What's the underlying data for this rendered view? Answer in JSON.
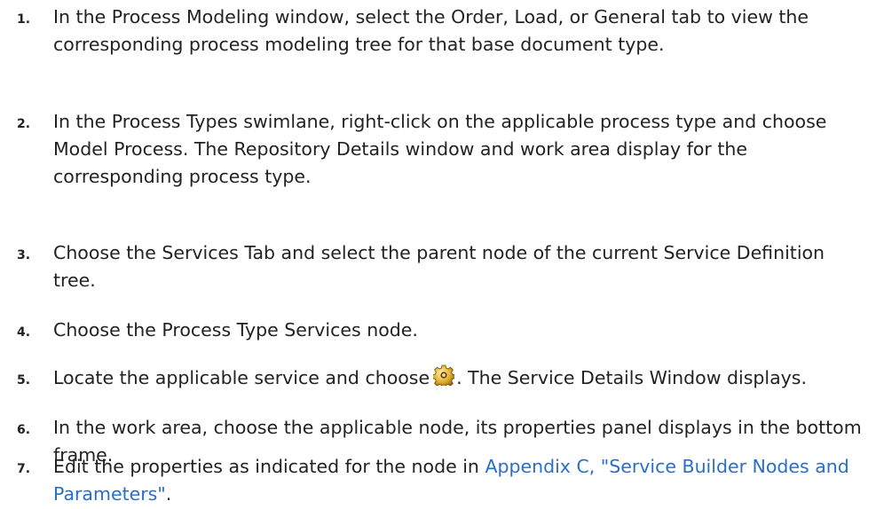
{
  "steps": [
    {
      "number": "1.",
      "text": "In the Process Modeling window, select the Order, Load, or General tab to view the corresponding process modeling tree for that base document type."
    },
    {
      "number": "2.",
      "text": "In the Process Types swimlane, right-click on the applicable process type and choose Model Process. The Repository Details window and work area display for the corresponding process type."
    },
    {
      "number": "3.",
      "text": "Choose the Services Tab and select the parent node of the current Service Definition tree."
    },
    {
      "number": "4.",
      "text": "Choose the Process Type Services node."
    },
    {
      "number": "5.",
      "text_before": "Locate the applicable service and choose",
      "icon": "gear-icon",
      "text_after": ". The Service Details Window displays."
    },
    {
      "number": "6.",
      "text": "In the work area, choose the applicable node, its properties panel displays in the bottom frame."
    },
    {
      "number": "7.",
      "text_before": "Edit the properties as indicated for the node in",
      "link_text": "Appendix C, \"Service Builder Nodes and Parameters\"",
      "text_after": "."
    }
  ],
  "colors": {
    "text": "#222222",
    "link": "#2a6ec8",
    "icon_gear": "#c8a020"
  }
}
